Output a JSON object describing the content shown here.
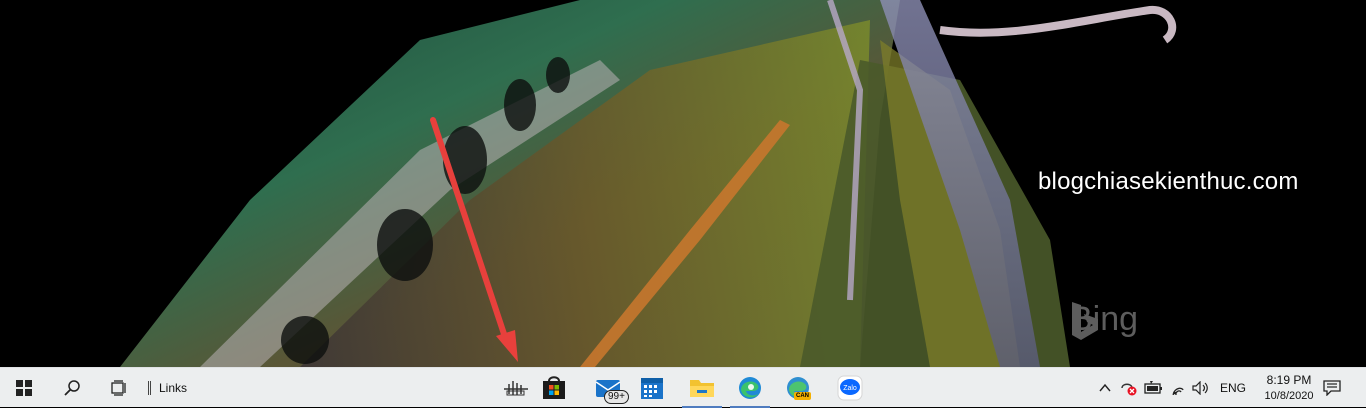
{
  "wallpaper": {
    "watermark_text": "blogchiasekienthuc.com",
    "bing_logo_text": "Bing"
  },
  "taskbar": {
    "start_icon": "windows-logo-icon",
    "search_icon": "search-icon",
    "task_view_icon": "task-view-icon",
    "links_label": "Links",
    "apps": [
      {
        "icon": "keyboard-spinner-icon"
      },
      {
        "icon": "microsoft-store-icon"
      },
      {
        "icon": "mail-icon",
        "badge": "99+"
      },
      {
        "icon": "calendar-icon"
      },
      {
        "icon": "file-explorer-icon"
      },
      {
        "icon": "edge-icon"
      },
      {
        "icon": "edge-canary-icon",
        "label": "CAN"
      },
      {
        "icon": "zalo-icon",
        "label": "Zalo"
      }
    ],
    "tray": {
      "chevron_icon": "chevron-up-icon",
      "icons": [
        "network-error-icon",
        "battery-icon",
        "wifi-icon",
        "volume-icon"
      ],
      "language": "ENG",
      "time": "8:19 PM",
      "date": "10/8/2020",
      "notification_icon": "action-center-icon"
    }
  }
}
